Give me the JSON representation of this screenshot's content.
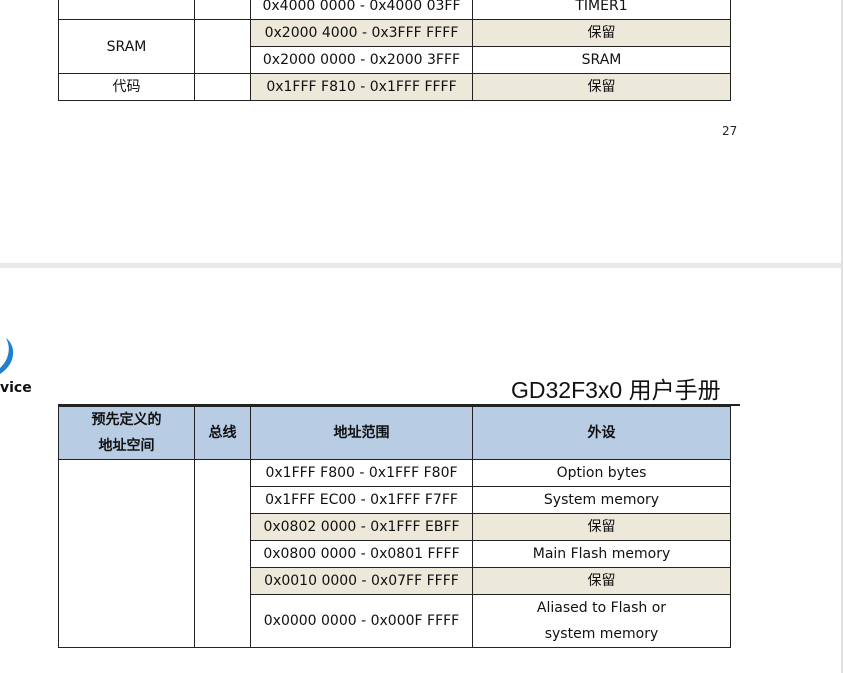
{
  "top_table": {
    "rows": [
      {
        "region": "",
        "bus": "",
        "range": "0x4000 0000 - 0x4000 03FF",
        "peripheral": "TIMER1",
        "reserved": false
      },
      {
        "region": "SRAM",
        "bus": "",
        "range": "0x2000 4000 - 0x3FFF FFFF",
        "peripheral": "保留",
        "reserved": true
      },
      {
        "region": "",
        "bus": "",
        "range": "0x2000 0000 - 0x2000 3FFF",
        "peripheral": "SRAM",
        "reserved": false
      },
      {
        "region": "代码",
        "bus": "",
        "range": "0x1FFF F810 - 0x1FFF FFFF",
        "peripheral": "保留",
        "reserved": true
      }
    ]
  },
  "page_number": "27",
  "logo": {
    "text": "vice"
  },
  "doc_title": "GD32F3x0 用户手册",
  "bottom_table": {
    "headers": {
      "region_line1": "预先定义的",
      "region_line2": "地址空间",
      "bus": "总线",
      "range": "地址范围",
      "peripheral": "外设"
    },
    "rows": [
      {
        "range": "0x1FFF F800 - 0x1FFF F80F",
        "peripheral": "Option bytes",
        "reserved": false
      },
      {
        "range": "0x1FFF EC00 - 0x1FFF F7FF",
        "peripheral": "System memory",
        "reserved": false
      },
      {
        "range": "0x0802 0000 - 0x1FFF EBFF",
        "peripheral": "保留",
        "reserved": true
      },
      {
        "range": "0x0800 0000 - 0x0801 FFFF",
        "peripheral": "Main Flash memory",
        "reserved": false
      },
      {
        "range": "0x0010 0000 - 0x07FF FFFF",
        "peripheral": "保留",
        "reserved": true
      },
      {
        "range": "0x0000 0000 - 0x000F FFFF",
        "peripheral_line1": "Aliased to Flash or",
        "peripheral_line2": "system memory",
        "reserved": false
      }
    ]
  },
  "colors": {
    "header_bg": "#b8cce4",
    "reserved_bg": "#ece8da",
    "logo_blue": "#1f7fd1"
  }
}
